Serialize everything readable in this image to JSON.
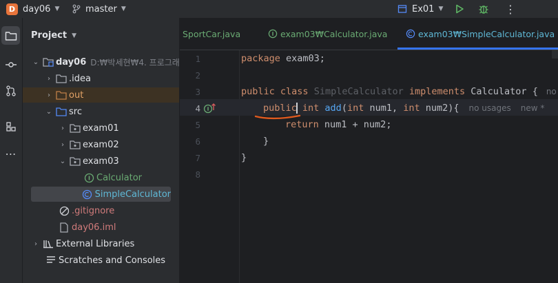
{
  "titlebar": {
    "project_badge": "D",
    "project_name": "day06",
    "branch": "master",
    "run_config": "Ex01"
  },
  "sidebar": {
    "project_label": "Project"
  },
  "tree": {
    "root_name": "day06",
    "root_path": "D:₩박세현₩4. 프로그래",
    "idea": ".idea",
    "out": "out",
    "src": "src",
    "exam01": "exam01",
    "exam02": "exam02",
    "exam03": "exam03",
    "calculator": "Calculator",
    "simple_calculator": "SimpleCalculator",
    "gitignore": ".gitignore",
    "iml": "day06.iml",
    "external_libraries": "External Libraries",
    "scratches": "Scratches and Consoles"
  },
  "tabs": {
    "tab1": "SportCar.java",
    "tab2": "exam03₩Calculator.java",
    "tab3": "exam03₩SimpleCalculator.java"
  },
  "gutter": {
    "l1": "1",
    "l2": "2",
    "l3": "3",
    "l4": "4",
    "l5": "5",
    "l6": "6",
    "l7": "7",
    "l8": "8"
  },
  "code": {
    "pkg_kw": "package",
    "pkg_name": " exam03;",
    "class_pub": "public",
    "class_kw": " class ",
    "class_name": "SimpleCalculator",
    "impl_kw": " implements ",
    "iface": "Calculator",
    "brace_open": " {",
    "class_hint": "no u",
    "m_pub": "public",
    "m_int": " int ",
    "m_name": "add",
    "m_paren": "(",
    "m_int2": "int",
    "m_arg1": " num1, ",
    "m_int3": "int",
    "m_arg2": " num2){",
    "m_hint1": "no usages",
    "m_hint2": "new *",
    "ret_kw": "return",
    "ret_expr": " num1 + num2;",
    "close_inner": "}",
    "close_outer": "}"
  },
  "colors": {
    "accent": "#3574f0",
    "annotation": "#e05a1e",
    "keyword": "#cf8e6d",
    "function": "#56a8f5",
    "interface_green": "#6aab73",
    "folder_orange": "#c07f48"
  }
}
